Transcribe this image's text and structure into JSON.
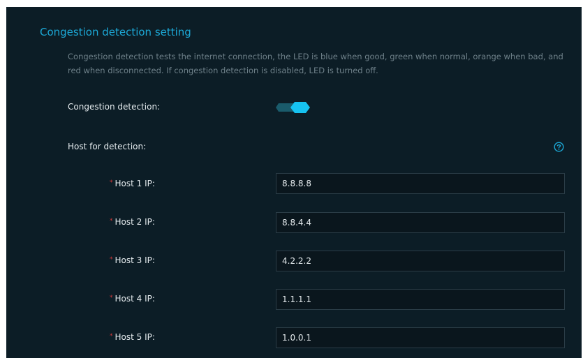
{
  "section": {
    "title": "Congestion detection setting",
    "description": "Congestion detection tests the internet connection, the LED is blue when good, green when normal, orange when bad, and red when disconnected. If congestion detection is disabled, LED is turned off."
  },
  "congestion": {
    "label": "Congestion detection:",
    "enabled": true
  },
  "host_detection": {
    "label": "Host for detection:",
    "help_icon": "question-circle-icon"
  },
  "hosts": [
    {
      "required_mark": "*",
      "label": "Host 1 IP:",
      "value": "8.8.8.8"
    },
    {
      "required_mark": "*",
      "label": "Host 2 IP:",
      "value": "8.8.4.4"
    },
    {
      "required_mark": "*",
      "label": "Host 3 IP:",
      "value": "4.2.2.2"
    },
    {
      "required_mark": "*",
      "label": "Host 4 IP:",
      "value": "1.1.1.1"
    },
    {
      "required_mark": "*",
      "label": "Host 5 IP:",
      "value": "1.0.0.1"
    }
  ],
  "colors": {
    "background": "#0c1d26",
    "accent": "#1ca8d6",
    "toggle_on": "#16c2f0",
    "required": "#d83a3a"
  }
}
